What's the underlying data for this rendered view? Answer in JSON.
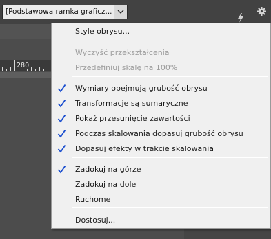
{
  "toolbar": {
    "style_select_value": "[Podstawowa ramka graficz...",
    "icons": [
      "chevron-down-icon",
      "lightning-icon",
      "gear-icon"
    ]
  },
  "ruler": {
    "label": "280"
  },
  "menu": {
    "items": [
      {
        "label": "Style obrysu...",
        "enabled": true,
        "checked": false
      },
      {
        "label": "Wyczyść przekształcenia",
        "enabled": false,
        "checked": false
      },
      {
        "label": "Przedefiniuj skalę na 100%",
        "enabled": false,
        "checked": false
      },
      {
        "label": "Wymiary obejmują grubość obrysu",
        "enabled": true,
        "checked": true
      },
      {
        "label": "Transformacje są sumaryczne",
        "enabled": true,
        "checked": true
      },
      {
        "label": "Pokaż przesunięcie zawartości",
        "enabled": true,
        "checked": true
      },
      {
        "label": "Podczas skalowania dopasuj grubość obrysu",
        "enabled": true,
        "checked": true
      },
      {
        "label": "Dopasuj efekty w trakcie skalowania",
        "enabled": true,
        "checked": true
      },
      {
        "label": "Zadokuj na górze",
        "enabled": true,
        "checked": true
      },
      {
        "label": "Zadokuj na dole",
        "enabled": true,
        "checked": false
      },
      {
        "label": "Ruchome",
        "enabled": true,
        "checked": false
      },
      {
        "label": "Dostosuj...",
        "enabled": true,
        "checked": false
      }
    ]
  },
  "colors": {
    "checkmark": "#1c4fcf",
    "menu_bg": "#f0f0f0",
    "app_bg": "#535353"
  }
}
